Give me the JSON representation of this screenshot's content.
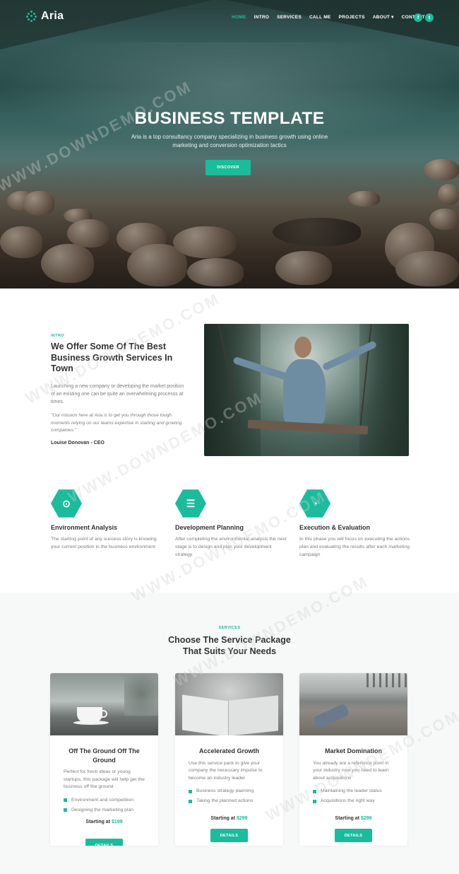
{
  "nav": {
    "logo": "Aria",
    "items": [
      "HOME",
      "INTRO",
      "SERVICES",
      "CALL ME",
      "PROJECTS",
      "ABOUT ▾",
      "CONTACT"
    ],
    "active_index": 0,
    "social": [
      "f",
      "t"
    ]
  },
  "hero": {
    "title": "BUSINESS TEMPLATE",
    "subtitle": "Aria is a top consultancy company specializing in business growth using online marketing and conversion optimization tactics",
    "button": "DISCOVER"
  },
  "intro": {
    "eyebrow": "INTRO",
    "title": "We Offer Some Of The Best Business Growth Services In Town",
    "text": "Launching a new company or developing the market position of an existing one can be quite an overwhelming processs at times.",
    "quote": "\"Our mission here at Aria is to get you through those tough moments relying on our teams expertise in starting and growing companies.\"",
    "author": "Louise Donovan - CEO"
  },
  "features": [
    {
      "icon": "binoculars-icon",
      "glyph": "⊙",
      "title": "Environment Analysis",
      "text": "The starting point of any success story is knowing your current position in the business environment"
    },
    {
      "icon": "list-icon",
      "glyph": "☰",
      "title": "Development Planning",
      "text": "After completing the environmental analysis the next stage is to design and plan your development strategy"
    },
    {
      "icon": "pie-chart-icon",
      "glyph": "◔",
      "title": "Execution & Evaluation",
      "text": "In this phase you will focus on executing the actions plan and evaluating the results after each marketing campaign"
    }
  ],
  "services": {
    "eyebrow": "SERVICES",
    "title_line1": "Choose The Service Package",
    "title_line2": "That Suits Your Needs",
    "packages": [
      {
        "title": "Off The Ground Off The Ground",
        "text": "Perfect for fresh ideas or young startups, this package will help get the business off the ground",
        "items": [
          "Environment and competition",
          "Designing the marketing plan"
        ],
        "price_label": "Starting at",
        "price": "$199",
        "button": "DETAILS"
      },
      {
        "title": "Accelerated Growth",
        "text": "Use this service pack to give your company the necessary impulse to become an industry leader",
        "items": [
          "Business strategy planning",
          "Taking the planned actions"
        ],
        "price_label": "Starting at",
        "price": "$299",
        "button": "DETAILS"
      },
      {
        "title": "Market Domination",
        "text": "You already are a reference point in your industry now you need to learn about acquisitions",
        "items": [
          "Maintaining the leader status",
          "Acquisitions the right way"
        ],
        "price_label": "Starting at",
        "price": "$299",
        "button": "DETAILS"
      }
    ]
  },
  "watermark": "WWW.DOWNDEMO.COM",
  "colors": {
    "accent": "#1bbc9b",
    "heading": "#333333",
    "body_text": "#7a7d79",
    "section_bg": "#f7f8f8"
  }
}
